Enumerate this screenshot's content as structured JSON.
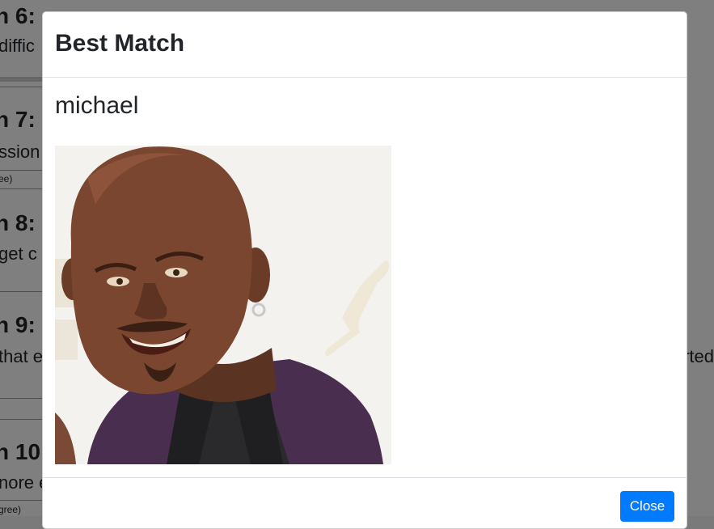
{
  "background": {
    "questions": [
      {
        "title": "n 6:",
        "text": "diffic"
      },
      {
        "title": "n 7:",
        "text": "ssion",
        "small": "ee)"
      },
      {
        "title": "n 8:",
        "text": "get c"
      },
      {
        "title": "n 9:",
        "text": "that e",
        "text_right": "rted"
      },
      {
        "title": "n 10",
        "text": "nore e",
        "small": "gree)"
      }
    ]
  },
  "modal": {
    "title": "Best Match",
    "match_name": "michael",
    "photo_icon": "portrait-photo",
    "close_label": "Close",
    "accent_color": "#007bff"
  }
}
